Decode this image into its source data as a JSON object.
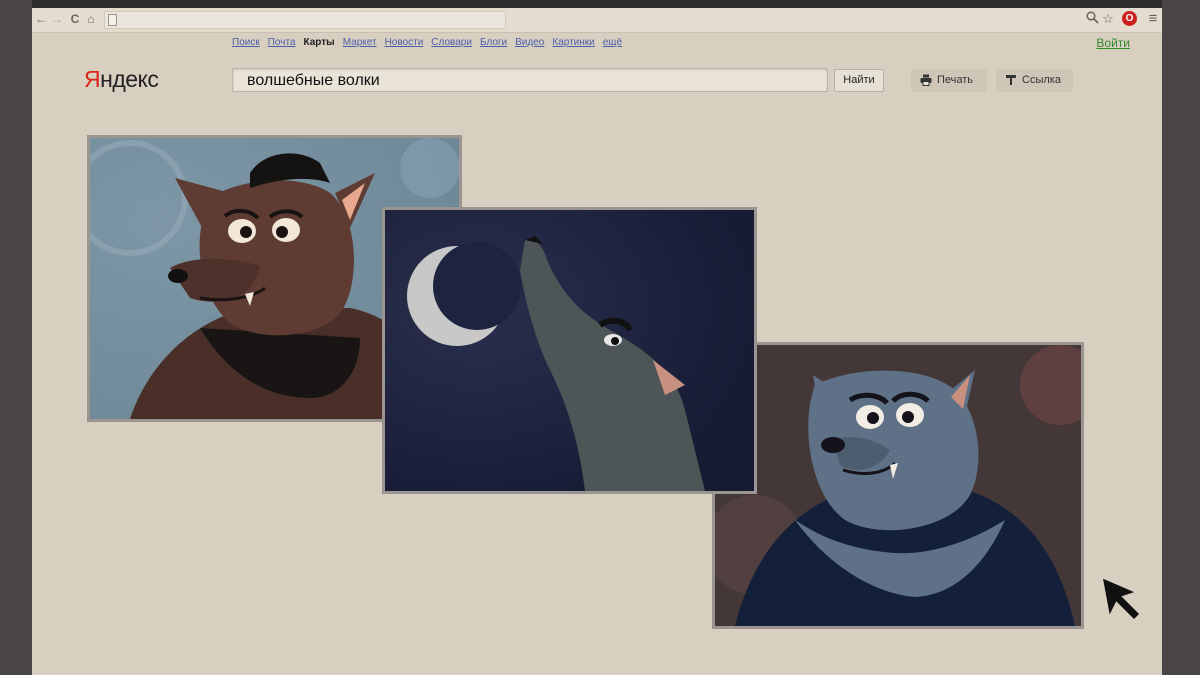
{
  "browser": {
    "nav": {
      "back": "←",
      "forward": "→",
      "reload": "C",
      "home": "⌂"
    },
    "address": "",
    "right_icons": [
      "zoom-icon",
      "star-icon",
      "opera-icon",
      "menu-icon"
    ],
    "opera_letter": "O",
    "menu_glyph": "≡"
  },
  "yandex": {
    "logo_first": "Я",
    "logo_rest": "ндекс",
    "services": [
      {
        "label": "Поиск",
        "active": false
      },
      {
        "label": "Почта",
        "active": false
      },
      {
        "label": "Карты",
        "active": true
      },
      {
        "label": "Маркет",
        "active": false
      },
      {
        "label": "Новости",
        "active": false
      },
      {
        "label": "Словари",
        "active": false
      },
      {
        "label": "Блоги",
        "active": false
      },
      {
        "label": "Видео",
        "active": false
      },
      {
        "label": "Картинки",
        "active": false
      },
      {
        "label": "ещё",
        "active": false
      }
    ],
    "login_label": "Войти",
    "search_query": "волшебные волки",
    "search_button": "Найти",
    "print_button": "Печать",
    "link_button": "Ссылка"
  },
  "results": [
    {
      "name": "brown-werewolf-image"
    },
    {
      "name": "howling-wolf-moon-image"
    },
    {
      "name": "grey-werewolf-image"
    }
  ],
  "colors": {
    "page_bg": "#d8cfc1",
    "logo_red": "#d8261b",
    "link_blue": "#4a5fa8",
    "login_green": "#2f8a2a"
  }
}
